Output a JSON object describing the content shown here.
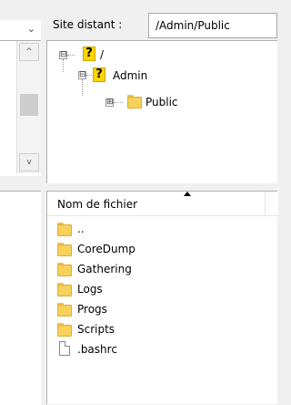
{
  "remote": {
    "label": "Site distant :",
    "path": "/Admin/Public"
  },
  "tree": {
    "root": {
      "label": "/",
      "expander": "⊟",
      "icon": "question-folder-icon"
    },
    "admin": {
      "label": "Admin",
      "expander": "⊟",
      "icon": "question-folder-icon"
    },
    "public": {
      "label": "Public",
      "expander": "⊞",
      "icon": "folder-icon"
    }
  },
  "files": {
    "header": {
      "name": "Nom de fichier",
      "sort": "ascending"
    },
    "rows": [
      {
        "name": "..",
        "type": "folder"
      },
      {
        "name": "CoreDump",
        "type": "folder"
      },
      {
        "name": "Gathering",
        "type": "folder"
      },
      {
        "name": "Logs",
        "type": "folder"
      },
      {
        "name": "Progs",
        "type": "folder"
      },
      {
        "name": "Scripts",
        "type": "folder"
      },
      {
        "name": ".bashrc",
        "type": "file"
      }
    ]
  },
  "left_pane": {
    "chevron": "⌄",
    "scroll_up": "^",
    "scroll_down": "v"
  },
  "colors": {
    "folder": "#f7d159",
    "unknown_folder": "#ffd500",
    "selection_bg": "#ffffff"
  }
}
